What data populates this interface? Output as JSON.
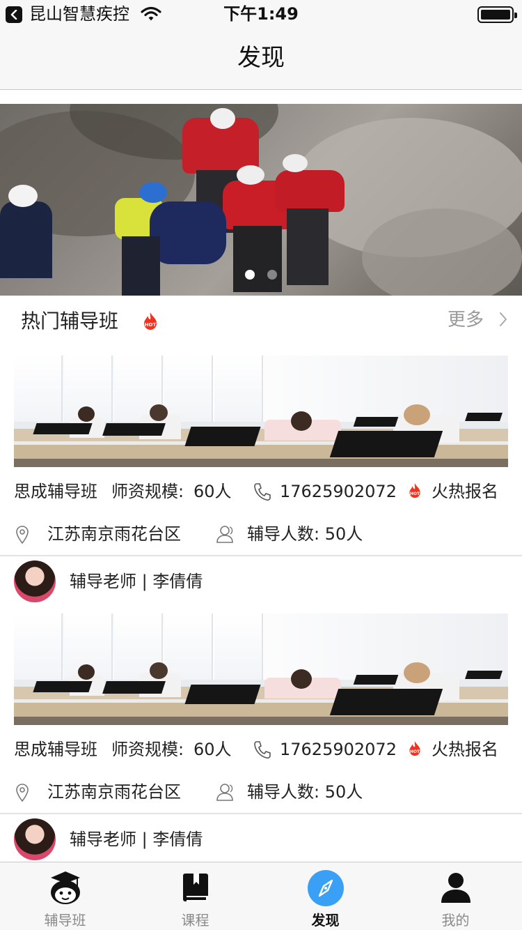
{
  "status_bar": {
    "app_name": "昆山智慧疾控",
    "time": "下午1:49"
  },
  "nav": {
    "title": "发现"
  },
  "banner": {
    "slide_count": 2,
    "active_slide": 0
  },
  "hot_section": {
    "title": "热门辅导班",
    "more_label": "更多"
  },
  "courses": [
    {
      "name": "思成辅导班",
      "faculty_label": "师资规模:",
      "faculty_value": "60人",
      "phone": "17625902072",
      "hot_label": "火热报名",
      "location": "江苏南京雨花台区",
      "students": "辅导人数: 50人",
      "teacher": "辅导老师 | 李倩倩"
    },
    {
      "name": "思成辅导班",
      "faculty_label": "师资规模:",
      "faculty_value": "60人",
      "phone": "17625902072",
      "hot_label": "火热报名",
      "location": "江苏南京雨花台区",
      "students": "辅导人数: 50人",
      "teacher": "辅导老师 | 李倩倩"
    }
  ],
  "tabbar": {
    "tabs": [
      {
        "label": "辅导班",
        "icon": "tutor-mascot-icon"
      },
      {
        "label": "课程",
        "icon": "book-icon"
      },
      {
        "label": "发现",
        "icon": "compass-icon"
      },
      {
        "label": "我的",
        "icon": "person-icon"
      }
    ],
    "active_index": 2
  },
  "colors": {
    "accent_blue": "#3aa0f5",
    "hot_red": "#f0321e",
    "text": "#222222",
    "muted": "#999999"
  }
}
